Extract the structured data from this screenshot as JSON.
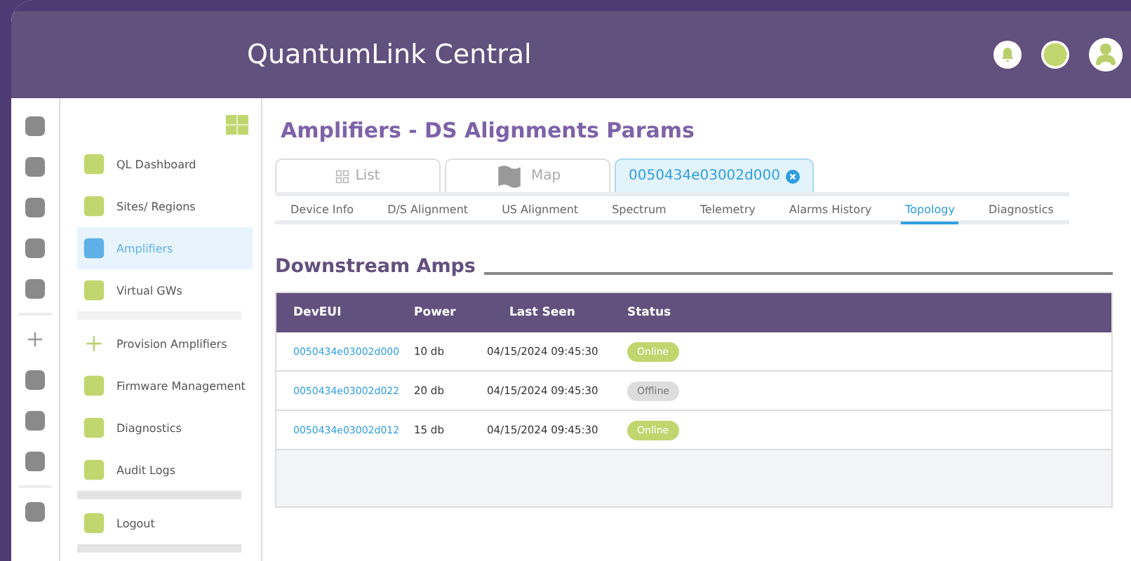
{
  "app": {
    "title": "QuantumLink Central"
  },
  "sidebar": {
    "items": [
      {
        "label": "QL Dashboard",
        "kind": "item",
        "selected": false
      },
      {
        "label": "Sites/ Regions",
        "kind": "item",
        "selected": false
      },
      {
        "label": "Amplifiers",
        "kind": "item",
        "selected": true
      },
      {
        "label": "Virtual GWs",
        "kind": "item",
        "selected": false
      },
      {
        "label": "Provision Amplifiers",
        "kind": "add",
        "selected": false
      },
      {
        "label": "Firmware Management",
        "kind": "item",
        "selected": false
      },
      {
        "label": "Diagnostics",
        "kind": "item",
        "selected": false
      },
      {
        "label": "Audit Logs",
        "kind": "item",
        "selected": false
      },
      {
        "label": "Logout",
        "kind": "item",
        "selected": false
      }
    ]
  },
  "page_title": "Amplifiers - DS Alignments Params",
  "view_tabs": [
    {
      "label": "List",
      "kind": "list",
      "selected": false
    },
    {
      "label": "Map",
      "kind": "map",
      "selected": false
    },
    {
      "label": "0050434e03002d000",
      "kind": "device",
      "selected": true
    }
  ],
  "detail_tabs": [
    {
      "label": "Device Info",
      "selected": false
    },
    {
      "label": "D/S Alignment",
      "selected": false
    },
    {
      "label": "US Alignment",
      "selected": false
    },
    {
      "label": "Spectrum",
      "selected": false
    },
    {
      "label": "Telemetry",
      "selected": false
    },
    {
      "label": "Alarms History",
      "selected": false
    },
    {
      "label": "Topology",
      "selected": true
    },
    {
      "label": "Diagnostics",
      "selected": false
    }
  ],
  "section_title": "Downstream Amps",
  "table": {
    "columns": [
      "DevEUI",
      "Power",
      "Last Seen",
      "Status"
    ],
    "rows": [
      {
        "deveui": "0050434e03002d000",
        "power": "10 db",
        "last_seen": "04/15/2024  09:45:30",
        "status": "Online",
        "online": true
      },
      {
        "deveui": "0050434e03002d022",
        "power": "20 db",
        "last_seen": "04/15/2024  09:45:30",
        "status": "Offline",
        "online": false
      },
      {
        "deveui": "0050434e03002d012",
        "power": "15 db",
        "last_seen": "04/15/2024  09:45:30",
        "status": "Online",
        "online": true
      }
    ]
  }
}
